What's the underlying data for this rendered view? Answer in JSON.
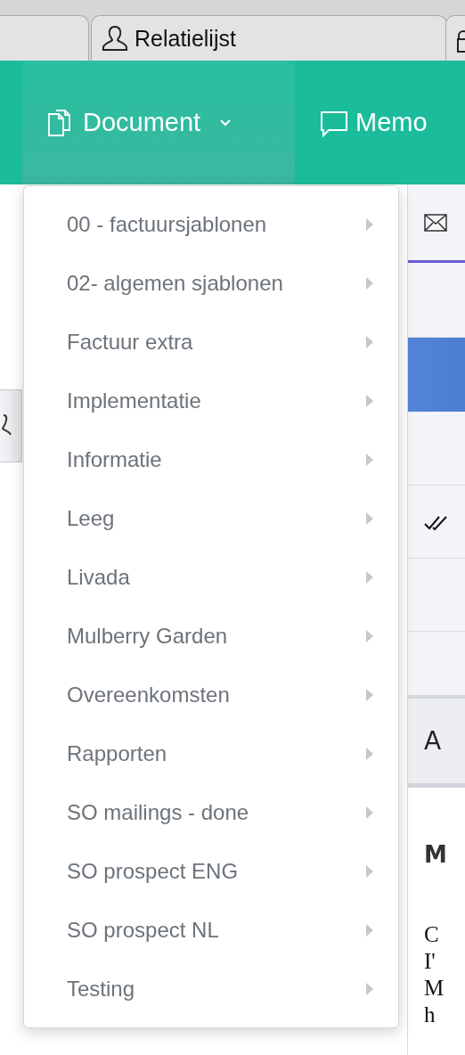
{
  "browser_tab": {
    "label": "Relatielijst"
  },
  "nav": [
    {
      "label": "Document",
      "kind": "dropdown",
      "selected": true
    },
    {
      "label": "Memo",
      "kind": "link",
      "selected": false
    }
  ],
  "menu": {
    "items": [
      {
        "label": "00 - factuursjablonen"
      },
      {
        "label": "02- algemen sjablonen"
      },
      {
        "label": "Factuur extra"
      },
      {
        "label": "Implementatie"
      },
      {
        "label": "Informatie"
      },
      {
        "label": "Leeg"
      },
      {
        "label": "Livada"
      },
      {
        "label": "Mulberry Garden"
      },
      {
        "label": "Overeenkomsten"
      },
      {
        "label": "Rapporten"
      },
      {
        "label": "SO mailings - done"
      },
      {
        "label": "SO prospect ENG"
      },
      {
        "label": "SO prospect NL"
      },
      {
        "label": "Testing"
      }
    ]
  },
  "right_panel": {
    "row_text": "A",
    "heading": "M",
    "body_lines": [
      "C",
      "I'",
      "M",
      "h"
    ]
  }
}
